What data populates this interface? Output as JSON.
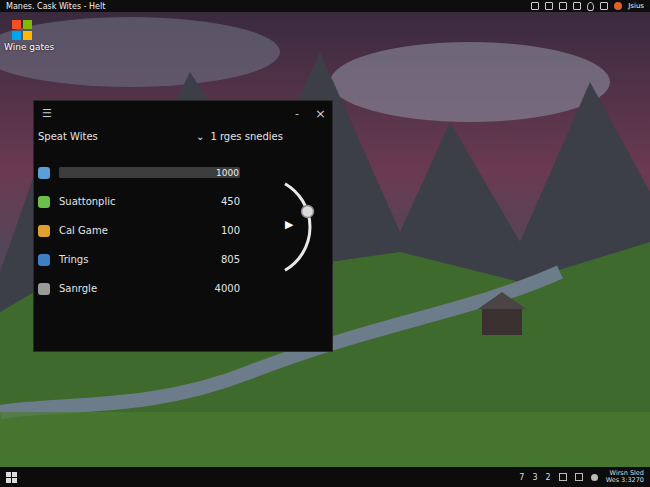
{
  "top_bar": {
    "title": "Manes. Cask Wites - Helt",
    "user": "Jsius"
  },
  "desktop_icons": [
    {
      "label": "Wine gates"
    }
  ],
  "window": {
    "menu": "☰",
    "minimize": "-",
    "close": "×",
    "title": "Speat Wites",
    "dropdown": {
      "icon": "⌄",
      "label": "1 rges snedies"
    },
    "rows": [
      {
        "kind": "bar",
        "value": "1000",
        "level": 1
      },
      {
        "kind": "item",
        "label": "Suattonplic",
        "value": "450"
      },
      {
        "kind": "item",
        "label": "Cal Game",
        "value": "100"
      },
      {
        "kind": "item",
        "label": "Trings",
        "value": "805"
      },
      {
        "kind": "item",
        "label": "Sanrgle",
        "value": "4000"
      }
    ]
  },
  "player": {
    "play": "▶",
    "level": 0.35
  },
  "taskbar": {
    "items": [
      "7",
      "3",
      "2"
    ],
    "clock": {
      "line1": "Wirsn Sled",
      "line2": "Wes 3:3270"
    }
  }
}
